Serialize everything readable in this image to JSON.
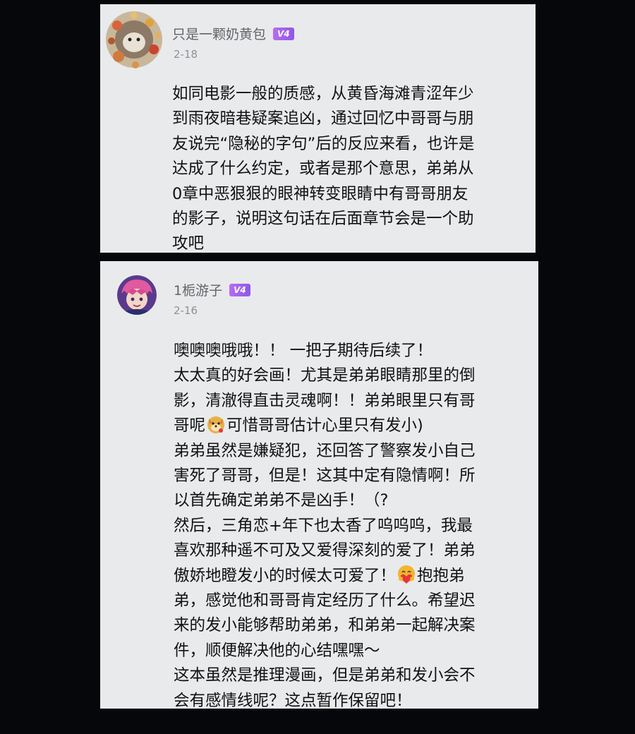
{
  "comments": [
    {
      "username": "只是一颗奶黄包",
      "badge": "V4",
      "date": "2-18",
      "avatar_icon": "floral-wreath-avatar",
      "lines": [
        "如同电影一般的质感，从黄昏海滩青涩年少",
        "到雨夜暗巷疑案追凶，通过回忆中哥哥与朋",
        "友说完“隐秘的字句”后的反应来看，也许是",
        "达成了什么约定，或者是那个意思，弟弟从",
        "0章中恶狠狠的眼神转变眼睛中有哥哥朋友",
        "的影子，说明这句话在后面章节会是一个助",
        "攻吧"
      ]
    },
    {
      "username": "1栀游子",
      "badge": "V4",
      "date": "2-16",
      "avatar_icon": "anime-character-avatar",
      "lines": {
        "l1": "噢噢噢哦哦！！ 一把子期待后续了！",
        "l2": "太太真的好会画！尤其是弟弟眼睛那里的倒",
        "l3": "影，清澈得直击灵魂啊！！弟弟眼里只有哥",
        "l4a": "哥呢",
        "l4b": "可惜哥哥估计心里只有发小)",
        "l5": "弟弟虽然是嫌疑犯，还回答了警察发小自己",
        "l6": "害死了哥哥，但是！这其中定有隐情啊！所",
        "l7": "以首先确定弟弟不是凶手！（?",
        "l8": "然后，三角恋+年下也太香了呜呜呜，我最",
        "l9": "喜欢那种遥不可及又爱得深刻的爱了！弟弟",
        "l10a": "傲娇地瞪发小的时候太可爱了！",
        "l10b": "抱抱弟",
        "l11": "弟，感觉他和哥哥肯定经历了什么。希望迟",
        "l12": "来的发小能够帮助弟弟，和弟弟一起解决案",
        "l13": "件，顺便解决他的心结嘿嘿～",
        "l14": "这本虽然是推理漫画，但是弟弟和发小会不",
        "l15": "会有感情线呢？这点暂作保留吧！"
      },
      "emojis": [
        "doge-emoji",
        "hug-heart-emoji"
      ]
    }
  ],
  "colors": {
    "background": "#05070a",
    "card": "#e9eaec",
    "username": "#636468",
    "date": "#8f9196",
    "badge_start": "#b76cf4",
    "badge_end": "#8f57ea",
    "body_text": "#111111"
  }
}
